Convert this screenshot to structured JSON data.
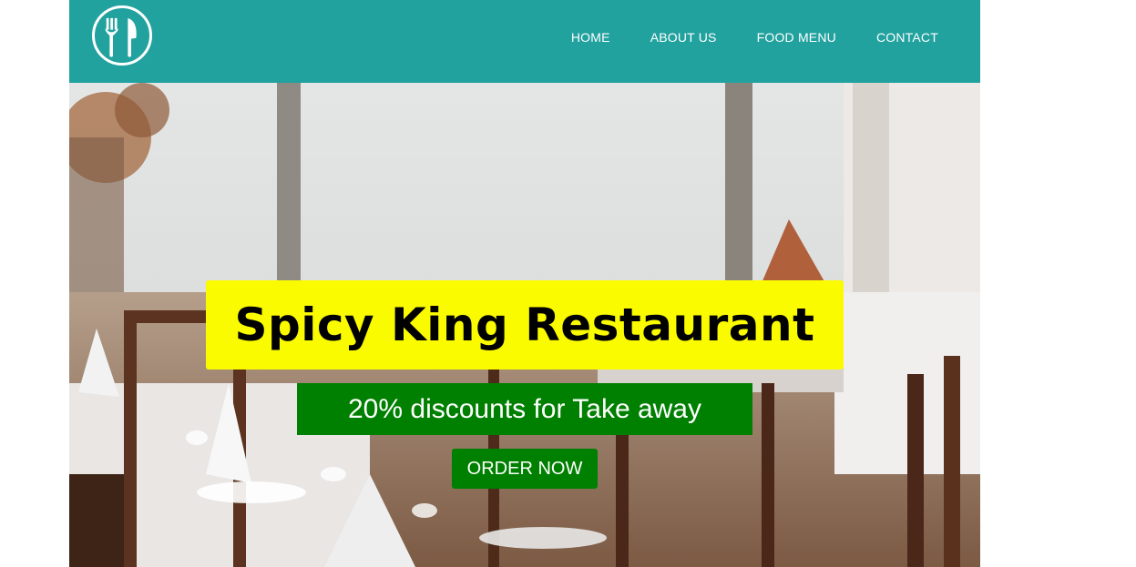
{
  "header": {
    "logo_icon": "fork-knife-icon",
    "nav": [
      {
        "label": "HOME"
      },
      {
        "label": "ABOUT US"
      },
      {
        "label": "FOOD MENU"
      },
      {
        "label": "CONTACT"
      }
    ]
  },
  "hero": {
    "background_image": "restaurant-dining-room-photo",
    "title": "Spicy King Restaurant",
    "promo": "20% discounts for Take away",
    "cta_label": "ORDER NOW"
  },
  "colors": {
    "header_bg": "#21a29f",
    "title_bg": "#fbfb00",
    "promo_bg": "#008000",
    "cta_bg": "#008000"
  }
}
